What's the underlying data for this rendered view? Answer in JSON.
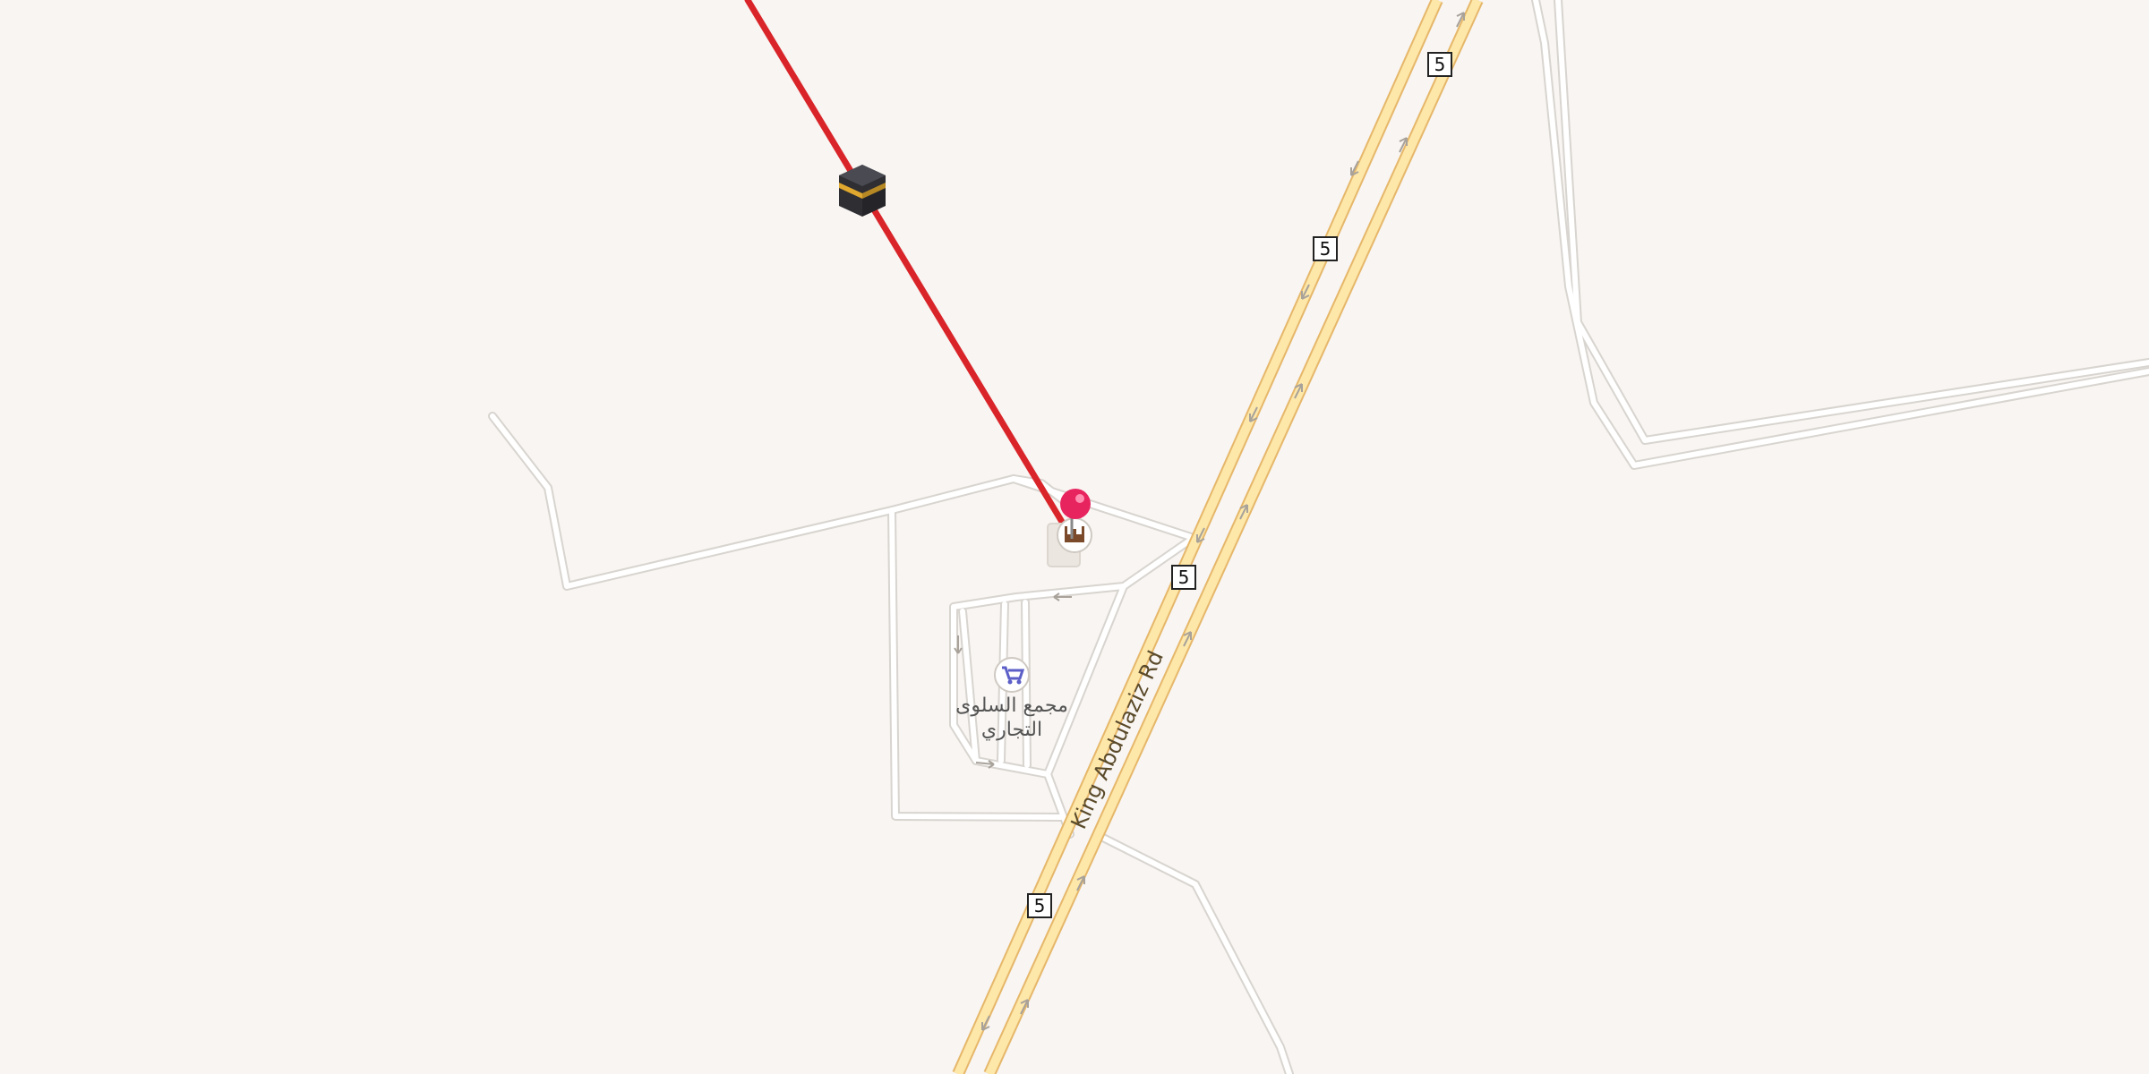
{
  "map": {
    "road_name": "King Abdulaziz Rd",
    "route_number": "5",
    "poi_label_line1": "مجمع السلوى",
    "poi_label_line2": "التجاري",
    "colors": {
      "background": "#f8f5f2",
      "highway_fill": "#fde7a9",
      "highway_casing": "#e6b76a",
      "minor_road_fill": "#ffffff",
      "minor_road_casing": "#d8d4cf",
      "qibla_line": "#d9252a",
      "pin": "#e8245f",
      "shop_icon": "#5b5fc7"
    },
    "icons": [
      "kaaba-icon",
      "location-pin-icon",
      "mosque-icon",
      "shopping-cart-icon",
      "one-way-arrow-icon"
    ]
  }
}
